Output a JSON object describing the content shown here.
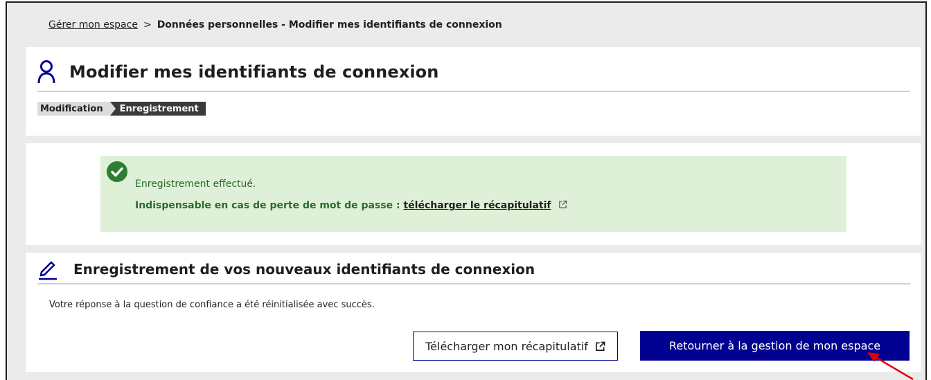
{
  "breadcrumb": {
    "parent": "Gérer mon espace",
    "separator": ">",
    "current": "Données personnelles - Modifier mes identifiants de connexion"
  },
  "header": {
    "title": "Modifier mes identifiants de connexion",
    "icon": "user-icon",
    "steps": [
      "Modification",
      "Enregistrement"
    ],
    "active_step": "Enregistrement"
  },
  "alert": {
    "type": "success",
    "icon": "check-circle-icon",
    "message": "Enregistrement effectué.",
    "hint_prefix": "Indispensable en cas de perte de mot de passe :",
    "hint_link": "télécharger le récapitulatif"
  },
  "record": {
    "icon": "pencil-icon",
    "title": "Enregistrement de vos nouveaux identifiants de connexion",
    "text": "Votre réponse à la question de confiance a été réinitialisée avec succès.",
    "download_button": "Télécharger mon récapitulatif",
    "return_button": "Retourner à la gestion de mon espace"
  },
  "colors": {
    "primary": "#000091",
    "success_bg": "#dff0d8",
    "success_text": "#2d6a2d",
    "success_icon": "#2e7d32",
    "annotation_arrow": "#e00000"
  }
}
